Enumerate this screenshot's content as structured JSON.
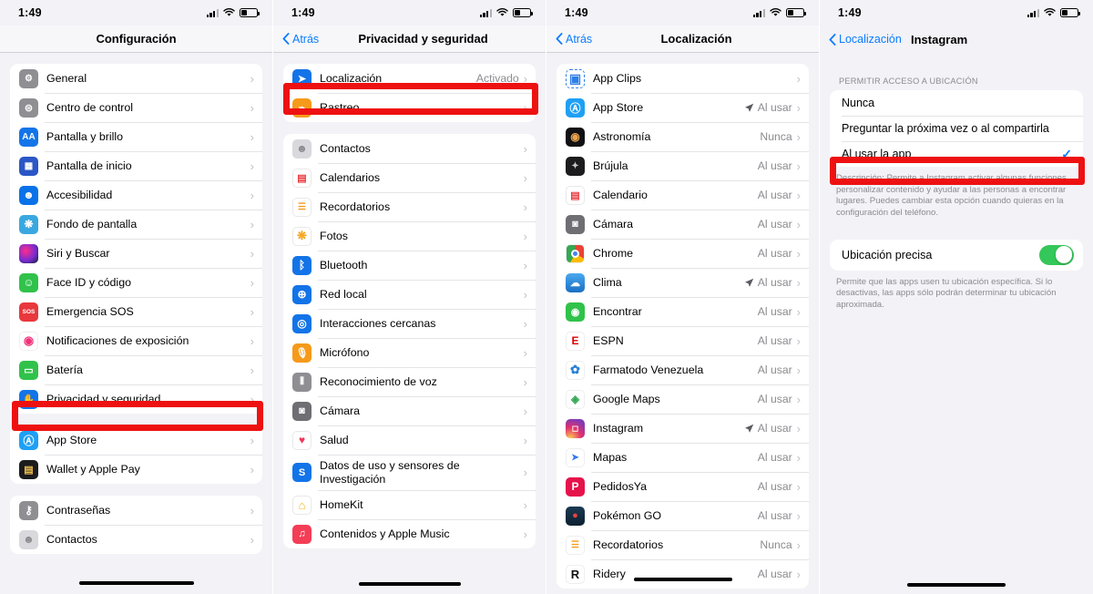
{
  "status_bar": {
    "time": "1:49",
    "signal_icon": "cellular-bars-icon",
    "wifi_icon": "wifi-icon",
    "battery_icon": "battery-icon"
  },
  "panels": [
    {
      "id": "settings",
      "nav": {
        "title": "Configuración",
        "back_label": null
      },
      "groups": [
        {
          "rows": [
            {
              "label": "General",
              "icon": "gear-icon",
              "icon_bg": "#8e8e93",
              "glyph": "⚙",
              "value": "",
              "chevron": "›"
            },
            {
              "label": "Centro de control",
              "icon": "control-center-icon",
              "icon_bg": "#8e8e93",
              "glyph": "⊜",
              "value": "",
              "chevron": "›"
            },
            {
              "label": "Pantalla y brillo",
              "icon": "display-brightness-icon",
              "icon_bg": "#1374e8",
              "glyph": "AA",
              "value": "",
              "chevron": "›"
            },
            {
              "label": "Pantalla de inicio",
              "icon": "home-screen-icon",
              "icon_bg": "#2b56c6",
              "glyph": "▦",
              "value": "",
              "chevron": "›"
            },
            {
              "label": "Accesibilidad",
              "icon": "accessibility-icon",
              "icon_bg": "#0a72e8",
              "glyph": "☻",
              "value": "",
              "chevron": "›"
            },
            {
              "label": "Fondo de pantalla",
              "icon": "wallpaper-icon",
              "icon_bg": "#3aa8e0",
              "glyph": "❋",
              "value": "",
              "chevron": "›"
            },
            {
              "label": "Siri y Buscar",
              "icon": "siri-icon",
              "icon_bg": "#2a1a3a",
              "glyph": "",
              "value": "",
              "chevron": "›"
            },
            {
              "label": "Face ID y código",
              "icon": "face-id-icon",
              "icon_bg": "#30c24a",
              "glyph": "☺",
              "value": "",
              "chevron": "›"
            },
            {
              "label": "Emergencia SOS",
              "icon": "sos-icon",
              "icon_bg": "#e8383d",
              "glyph": "SOS",
              "value": "",
              "chevron": "›"
            },
            {
              "label": "Notificaciones de exposición",
              "icon": "exposure-notification-icon",
              "icon_bg": "#ffffff",
              "glyph": "◉",
              "value": "",
              "chevron": "›"
            },
            {
              "label": "Batería",
              "icon": "battery-settings-icon",
              "icon_bg": "#30c24a",
              "glyph": "▭",
              "value": "",
              "chevron": "›"
            },
            {
              "label": "Privacidad y seguridad",
              "icon": "privacy-hand-icon",
              "icon_bg": "#1374e8",
              "glyph": "✋",
              "value": "",
              "chevron": "›",
              "highlighted": true
            }
          ]
        },
        {
          "rows": [
            {
              "label": "App Store",
              "icon": "app-store-icon",
              "icon_bg": "#1ea0f5",
              "glyph": "Ⓐ",
              "value": "",
              "chevron": "›"
            },
            {
              "label": "Wallet y Apple Pay",
              "icon": "wallet-icon",
              "icon_bg": "#1c1c1e",
              "glyph": "▤",
              "value": "",
              "chevron": "›"
            }
          ]
        },
        {
          "rows": [
            {
              "label": "Contraseñas",
              "icon": "passwords-key-icon",
              "icon_bg": "#8e8e93",
              "glyph": "⚷",
              "value": "",
              "chevron": "›"
            },
            {
              "label": "Contactos",
              "icon": "contacts-icon",
              "icon_bg": "#d8d8dd",
              "glyph": "☻",
              "value": "",
              "chevron": "›"
            }
          ]
        }
      ]
    },
    {
      "id": "privacy",
      "nav": {
        "title": "Privacidad y seguridad",
        "back_label": "Atrás"
      },
      "groups": [
        {
          "rows": [
            {
              "label": "Localización",
              "icon": "location-arrow-icon",
              "icon_bg": "#1374e8",
              "glyph": "➤",
              "value": "Activado",
              "chevron": "›",
              "highlighted": true
            },
            {
              "label": "Rastreo",
              "icon": "tracking-icon",
              "icon_bg": "#f59a1a",
              "glyph": "⌁",
              "value": "",
              "chevron": "›"
            }
          ]
        },
        {
          "rows": [
            {
              "label": "Contactos",
              "icon": "contacts-icon",
              "icon_bg": "#d8d8dd",
              "glyph": "☻",
              "value": "",
              "chevron": "›"
            },
            {
              "label": "Calendarios",
              "icon": "calendar-icon",
              "icon_bg": "#ffffff",
              "glyph": "▤",
              "value": "",
              "chevron": "›"
            },
            {
              "label": "Recordatorios",
              "icon": "reminders-icon",
              "icon_bg": "#ffffff",
              "glyph": "☰",
              "value": "",
              "chevron": "›"
            },
            {
              "label": "Fotos",
              "icon": "photos-icon",
              "icon_bg": "#ffffff",
              "glyph": "❋",
              "value": "",
              "chevron": "›"
            },
            {
              "label": "Bluetooth",
              "icon": "bluetooth-icon",
              "icon_bg": "#1374e8",
              "glyph": "ᛒ",
              "value": "",
              "chevron": "›"
            },
            {
              "label": "Red local",
              "icon": "local-network-icon",
              "icon_bg": "#1374e8",
              "glyph": "⊕",
              "value": "",
              "chevron": "›"
            },
            {
              "label": "Interacciones cercanas",
              "icon": "nearby-interactions-icon",
              "icon_bg": "#1374e8",
              "glyph": "◎",
              "value": "",
              "chevron": "›"
            },
            {
              "label": "Micrófono",
              "icon": "microphone-icon",
              "icon_bg": "#f59a1a",
              "glyph": "🎙",
              "value": "",
              "chevron": "›"
            },
            {
              "label": "Reconocimiento de voz",
              "icon": "speech-recognition-icon",
              "icon_bg": "#8e8e93",
              "glyph": "⦀",
              "value": "",
              "chevron": "›"
            },
            {
              "label": "Cámara",
              "icon": "camera-icon",
              "icon_bg": "#6e6e73",
              "glyph": "◙",
              "value": "",
              "chevron": "›"
            },
            {
              "label": "Salud",
              "icon": "health-heart-icon",
              "icon_bg": "#ffffff",
              "glyph": "♥",
              "value": "",
              "chevron": "›"
            },
            {
              "label": "Datos de uso y sensores de Investigación",
              "icon": "research-sensor-icon",
              "icon_bg": "#1374e8",
              "glyph": "S",
              "value": "",
              "chevron": "›"
            },
            {
              "label": "HomeKit",
              "icon": "homekit-icon",
              "icon_bg": "#ffffff",
              "glyph": "⌂",
              "value": "",
              "chevron": "›"
            },
            {
              "label": "Contenidos y Apple Music",
              "icon": "apple-music-icon",
              "icon_bg": "#f43d56",
              "glyph": "♫",
              "value": "",
              "chevron": "›"
            }
          ]
        }
      ]
    },
    {
      "id": "location",
      "nav": {
        "title": "Localización",
        "back_label": "Atrás"
      },
      "groups": [
        {
          "rows": [
            {
              "label": "App Clips",
              "icon": "app-clips-icon",
              "icon_bg": "#ffffff",
              "glyph": "▣",
              "value": "",
              "chevron": "›"
            },
            {
              "label": "App Store",
              "icon": "app-store-icon",
              "icon_bg": "#1ea0f5",
              "glyph": "Ⓐ",
              "value": "Al usar",
              "chevron": "›",
              "arrow": true
            },
            {
              "label": "Astronomía",
              "icon": "astronomy-icon",
              "icon_bg": "#111114",
              "glyph": "◉",
              "value": "Nunca",
              "chevron": "›"
            },
            {
              "label": "Brújula",
              "icon": "compass-icon",
              "icon_bg": "#1c1c1e",
              "glyph": "✦",
              "value": "Al usar",
              "chevron": "›"
            },
            {
              "label": "Calendario",
              "icon": "calendar-icon",
              "icon_bg": "#ffffff",
              "glyph": "▤",
              "value": "Al usar",
              "chevron": "›"
            },
            {
              "label": "Cámara",
              "icon": "camera-icon",
              "icon_bg": "#6e6e73",
              "glyph": "◙",
              "value": "Al usar",
              "chevron": "›"
            },
            {
              "label": "Chrome",
              "icon": "chrome-icon",
              "icon_bg": "#ffffff",
              "glyph": "◍",
              "value": "Al usar",
              "chevron": "›"
            },
            {
              "label": "Clima",
              "icon": "weather-icon",
              "icon_bg": "#2a8fe0",
              "glyph": "☁",
              "value": "Al usar",
              "chevron": "›",
              "arrow": true
            },
            {
              "label": "Encontrar",
              "icon": "find-my-icon",
              "icon_bg": "#30c24a",
              "glyph": "◉",
              "value": "Al usar",
              "chevron": "›"
            },
            {
              "label": "ESPN",
              "icon": "espn-icon",
              "icon_bg": "#ffffff",
              "glyph": "E",
              "value": "Al usar",
              "chevron": "›"
            },
            {
              "label": "Farmatodo Venezuela",
              "icon": "farmatodo-icon",
              "icon_bg": "#ffffff",
              "glyph": "✿",
              "value": "Al usar",
              "chevron": "›"
            },
            {
              "label": "Google Maps",
              "icon": "google-maps-icon",
              "icon_bg": "#ffffff",
              "glyph": "◈",
              "value": "Al usar",
              "chevron": "›"
            },
            {
              "label": "Instagram",
              "icon": "instagram-icon",
              "icon_bg": "#d62976",
              "glyph": "◻",
              "value": "Al usar",
              "chevron": "›",
              "arrow": true
            },
            {
              "label": "Mapas",
              "icon": "apple-maps-icon",
              "icon_bg": "#ffffff",
              "glyph": "➤",
              "value": "Al usar",
              "chevron": "›"
            },
            {
              "label": "PedidosYa",
              "icon": "pedidosya-icon",
              "icon_bg": "#e5124b",
              "glyph": "P",
              "value": "Al usar",
              "chevron": "›"
            },
            {
              "label": "Pokémon GO",
              "icon": "pokemon-go-icon",
              "icon_bg": "#1a3a52",
              "glyph": "●",
              "value": "Al usar",
              "chevron": "›"
            },
            {
              "label": "Recordatorios",
              "icon": "reminders-icon",
              "icon_bg": "#ffffff",
              "glyph": "☰",
              "value": "Nunca",
              "chevron": "›"
            },
            {
              "label": "Ridery",
              "icon": "ridery-icon",
              "icon_bg": "#ffffff",
              "glyph": "R",
              "value": "Al usar",
              "chevron": "›"
            }
          ]
        }
      ]
    },
    {
      "id": "instagram",
      "nav": {
        "title": "Instagram",
        "back_label": "Localización"
      },
      "section_header": "PERMITIR ACCESO A UBICACIÓN",
      "choices": [
        {
          "label": "Nunca",
          "selected": false
        },
        {
          "label": "Preguntar la próxima vez o al compartirla",
          "selected": false
        },
        {
          "label": "Al usar la app",
          "selected": true,
          "check": "✓",
          "highlighted": true
        }
      ],
      "description": "Descripción: Permite a Instagram activar algunas funciones, personalizar contenido y ayudar a las personas a encontrar lugares. Puedes cambiar esta opción cuando quieras en la configuración del teléfono.",
      "toggle": {
        "label": "Ubicación precisa",
        "on": true
      },
      "toggle_footer": "Permite que las apps usen tu ubicación específica. Si lo desactivas, las apps sólo podrán determinar tu ubicación aproximada."
    }
  ],
  "colors": {
    "highlight": "#ee1111",
    "accent_blue": "#0a7cff",
    "toggle_green": "#34c759",
    "bg": "#f2f2f7"
  }
}
